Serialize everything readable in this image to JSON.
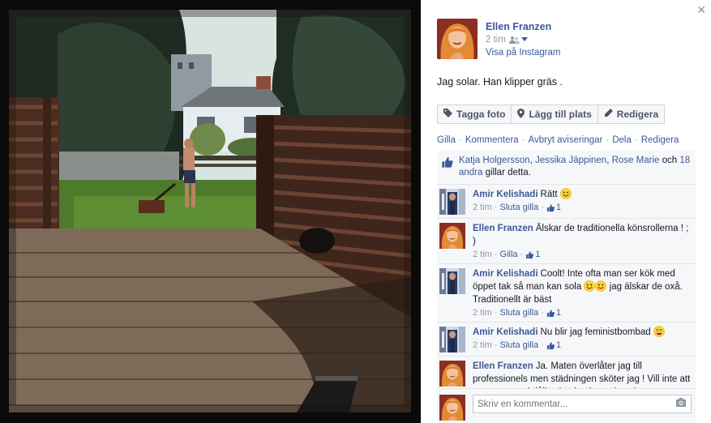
{
  "photo": {
    "alt": ""
  },
  "post": {
    "author": "Ellen Franzen",
    "time": "2 tim",
    "via": "Visa på Instagram",
    "status": "Jag solar. Han klipper gräs ."
  },
  "buttons": {
    "tag": "Tagga foto",
    "place": "Lägg till plats",
    "edit": "Redigera"
  },
  "actions": {
    "like": "Gilla",
    "comment": "Kommentera",
    "unfollow": "Avbryt aviseringar",
    "share": "Dela",
    "edit": "Redigera",
    "separator": "·"
  },
  "likes": {
    "names": [
      "Katja Holgersson",
      "Jessika Jäppinen",
      "Rose Marie"
    ],
    "sep1": ", ",
    "sep2": ", ",
    "and": " och ",
    "others": "18 andra",
    "suffix": " gillar detta."
  },
  "comments": [
    {
      "name": "Amir Kelishadi",
      "text": "Rätt",
      "time": "2 tim",
      "action": "Sluta gilla",
      "likes": "1"
    },
    {
      "name": "Ellen Franzen",
      "text": "Älskar de traditionella könsrollerna ! ; )",
      "time": "2 tim",
      "action": "Gilla",
      "likes": "1"
    },
    {
      "name": "Amir Kelishadi",
      "text": "Coolt! Inte ofta man ser kök med öppet tak så man kan sola",
      "text2": " jag älskar de oxå. Traditionellt är bäst",
      "time": "2 tim",
      "action": "Sluta gilla",
      "likes": "1"
    },
    {
      "name": "Amir Kelishadi",
      "text": "Nu blir jag feministbombad",
      "time": "2 tim",
      "action": "Sluta gilla",
      "likes": "1"
    },
    {
      "name": "Ellen Franzen",
      "text": "Ja. Maten överlåter jag till professionels men städningen sköter jag ! Vill inte att ngn man med dålig simultankapacitet ska",
      "time": "",
      "action": "",
      "likes": ""
    }
  ],
  "composer": {
    "placeholder": "Skriv en kommentar..."
  },
  "colors": {
    "link": "#3b5998",
    "muted": "#9197a3",
    "panel_bg": "#f6f7f9"
  }
}
